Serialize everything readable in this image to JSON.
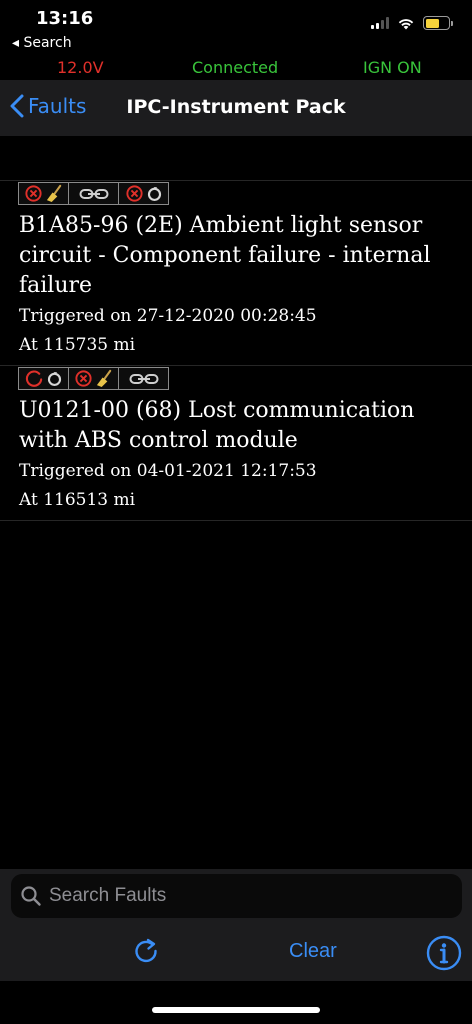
{
  "status_bar": {
    "time": "13:16",
    "back_app": "◂ Search"
  },
  "connection": {
    "voltage": "12.0V",
    "status": "Connected",
    "ignition": "IGN ON"
  },
  "nav": {
    "back_label": "Faults",
    "title": "IPC-Instrument Pack"
  },
  "faults": [
    {
      "badges": [
        "error-clear-icon",
        "link-icon",
        "error-ring-icon"
      ],
      "title": "B1A85-96 (2E) Ambient light sensor circuit - Component failure - internal failure",
      "triggered": "Triggered on 27-12-2020 00:28:45",
      "mileage": "At 115735 mi"
    },
    {
      "badges": [
        "pending-ring-icon",
        "error-clear-icon",
        "link-icon"
      ],
      "title": "U0121-00 (68) Lost communication with ABS control module",
      "triggered": "Triggered on 04-01-2021 12:17:53",
      "mileage": "At 116513 mi"
    }
  ],
  "search": {
    "placeholder": "Search Faults",
    "value": ""
  },
  "toolbar": {
    "clear_label": "Clear"
  },
  "colors": {
    "accent": "#3a8df5",
    "error": "#e0302a",
    "ok": "#39c43b",
    "battery": "#f6d33c"
  }
}
